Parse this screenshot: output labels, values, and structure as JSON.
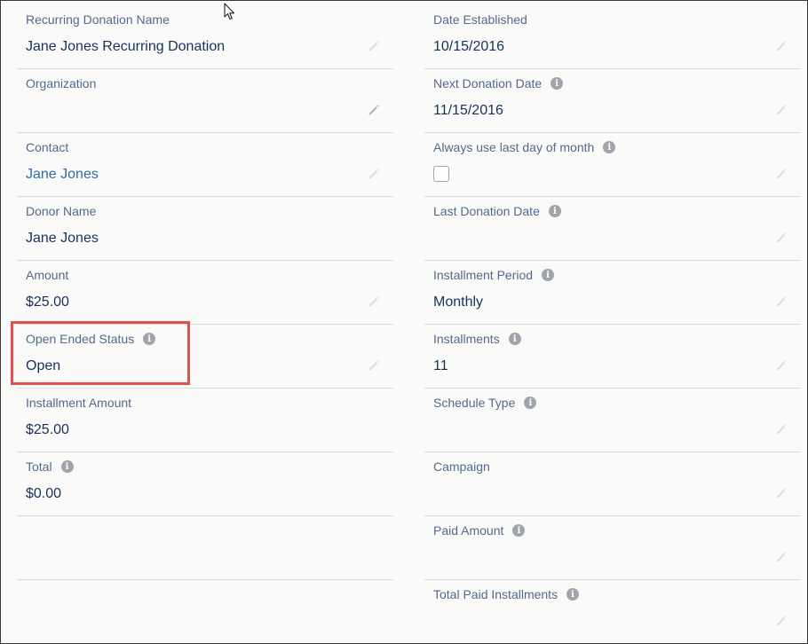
{
  "left_fields": [
    {
      "label": "Recurring Donation Name",
      "value": "Jane Jones Recurring Donation",
      "info": false
    },
    {
      "label": "Organization",
      "value": "",
      "info": false
    },
    {
      "label": "Contact",
      "value": "Jane Jones",
      "info": false,
      "link": true
    },
    {
      "label": "Donor Name",
      "value": "Jane Jones",
      "info": false
    },
    {
      "label": "Amount",
      "value": "$25.00",
      "info": false
    },
    {
      "label": "Open Ended Status",
      "value": "Open",
      "info": true
    },
    {
      "label": "Installment Amount",
      "value": "$25.00",
      "info": false
    },
    {
      "label": "Total",
      "value": "$0.00",
      "info": true
    }
  ],
  "right_fields": [
    {
      "label": "Date Established",
      "value": "10/15/2016",
      "info": false
    },
    {
      "label": "Next Donation Date",
      "value": "11/15/2016",
      "info": true
    },
    {
      "label": "Always use last day of month",
      "value": "",
      "info": true,
      "checkbox": true,
      "checked": false
    },
    {
      "label": "Last Donation Date",
      "value": "",
      "info": true
    },
    {
      "label": "Installment Period",
      "value": "Monthly",
      "info": true
    },
    {
      "label": "Installments",
      "value": "11",
      "info": true
    },
    {
      "label": "Schedule Type",
      "value": "",
      "info": true
    },
    {
      "label": "Campaign",
      "value": "",
      "info": false
    },
    {
      "label": "Paid Amount",
      "value": "",
      "info": true
    },
    {
      "label": "Total Paid Installments",
      "value": "",
      "info": true
    }
  ],
  "icons": {
    "info": "info-icon",
    "edit": "pencil-edit-icon",
    "cursor": "mouse-pointer-icon"
  },
  "info_glyph": "i",
  "colors": {
    "label": "#54698d",
    "value": "#16325c",
    "link": "#2e6dac",
    "highlight": "#d9534f",
    "divider": "#dddbda"
  }
}
